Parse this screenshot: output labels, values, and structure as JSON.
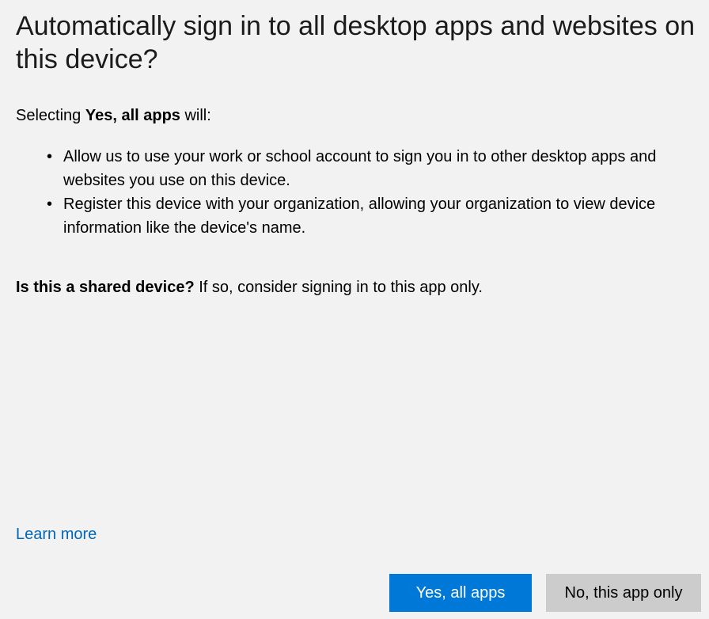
{
  "dialog": {
    "title": "Automatically sign in to all desktop apps and websites on this device?",
    "intro_prefix": "Selecting ",
    "intro_bold": "Yes, all apps",
    "intro_suffix": " will:",
    "bullets": [
      "Allow us to use your work or school account to sign you in to other desktop apps and websites you use on this device.",
      "Register this device with your organization, allowing your organization to view device information like the device's name."
    ],
    "shared_bold": "Is this a shared device?",
    "shared_text": " If so, consider signing in to this app only.",
    "learn_more": "Learn more"
  },
  "buttons": {
    "yes_label": "Yes, all apps",
    "no_label": "No, this app only"
  },
  "colors": {
    "background": "#f2f2f2",
    "primary_button": "#0078d7",
    "secondary_button": "#cccccc",
    "link": "#0067b8"
  }
}
